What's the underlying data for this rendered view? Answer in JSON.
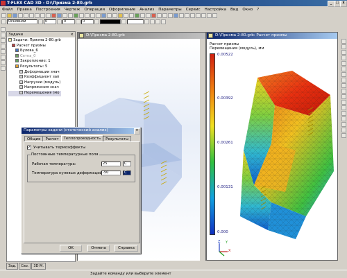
{
  "app": {
    "title": "T-FLEX CAD 3D - D:\\Призма 2-80.grb",
    "window_controls": [
      "_",
      "□",
      "x"
    ]
  },
  "menu": {
    "items": [
      "Файл",
      "Правка",
      "Построения",
      "Чертеж",
      "Операции",
      "Оформление",
      "Анализ",
      "Параметры",
      "Сервис",
      "Настройка",
      "Вид",
      "Окно",
      "?"
    ]
  },
  "toolbar": {
    "layer_combo": "Основной",
    "value1": "0",
    "value2": "0",
    "value3": "0"
  },
  "left_panel": {
    "title": "Задачи",
    "tree": [
      {
        "label": "Задачи: Призма 2-80.grb",
        "indent": 0
      },
      {
        "label": "Расчет призмы",
        "indent": 1
      },
      {
        "label": "Булева_6",
        "indent": 2
      },
      {
        "label": "Сетка_0",
        "indent": 2
      },
      {
        "label": "Закрепление: 1",
        "indent": 2
      },
      {
        "label": "Результаты: 5",
        "indent": 2
      },
      {
        "label": "Деформации знач",
        "indent": 3
      },
      {
        "label": "Коэффициент зап",
        "indent": 3
      },
      {
        "label": "Нагрузки (модуль)",
        "indent": 3
      },
      {
        "label": "Напряжения знач",
        "indent": 3
      },
      {
        "label": "Перемещения (мо",
        "indent": 3
      }
    ],
    "bottom_tabs": [
      "Зад.",
      "Сво.",
      "3D М."
    ]
  },
  "doc1": {
    "title": "D:\\Призма 2-80.grb"
  },
  "doc2": {
    "title": "D:\\Призма 2-80.grb: Расчет призмы",
    "result_title": "Расчет призмы",
    "result_subtitle": "Перемещения (модуль), мм",
    "legend": {
      "labels": [
        "0.00522",
        "0.00392",
        "0.00261",
        "0.00131",
        "0.000"
      ],
      "colors": [
        "#d02010",
        "#f08010",
        "#f0e020",
        "#30c040",
        "#10a0e0",
        "#1030c0"
      ]
    },
    "axes": [
      "X",
      "Y",
      "Z"
    ]
  },
  "dialog": {
    "title": "Параметры задачи (статический анализ)",
    "tabs": [
      "Общие",
      "Расчет",
      "Теплопроводность",
      "Результаты"
    ],
    "active_tab": 2,
    "checkbox_label": "Учитывать термоэффекты",
    "checkbox_checked": true,
    "group_title": "Постоянные температурные поля",
    "field1_label": "Рабочая температура:",
    "field1_value": "25",
    "field1_unit": "C",
    "field2_label": "Температура нулевых деформаций:",
    "field2_value": "-50",
    "field2_unit": "C",
    "buttons": [
      "OK",
      "Отмена",
      "Справка"
    ]
  },
  "status": {
    "text": "Задайте команду или выберите элемент"
  }
}
